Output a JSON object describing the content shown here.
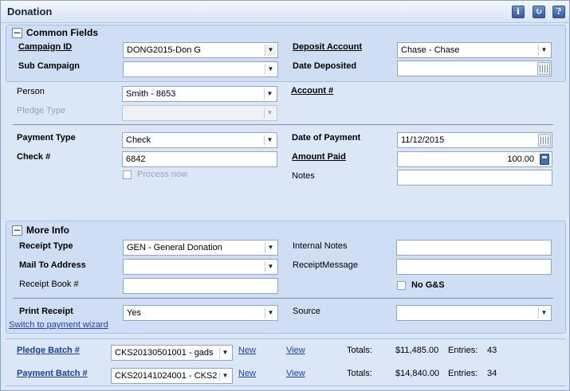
{
  "title": "Donation",
  "header_icons": [
    "info-icon",
    "refresh-icon",
    "help-icon"
  ],
  "common": {
    "section": "Common Fields",
    "campaign_id": {
      "label": "Campaign ID",
      "value": "DONG2015-Don G"
    },
    "sub_campaign": {
      "label": "Sub Campaign",
      "value": ""
    },
    "deposit_account": {
      "label": "Deposit Account",
      "value": "Chase - Chase"
    },
    "date_deposited": {
      "label": "Date Deposited",
      "value": ""
    }
  },
  "person": {
    "label": "Person",
    "value": "Smith - 8653"
  },
  "account_no": {
    "label": "Account #"
  },
  "pledge_type": {
    "label": "Pledge Type",
    "value": ""
  },
  "payment": {
    "type": {
      "label": "Payment Type",
      "value": "Check"
    },
    "check_no": {
      "label": "Check #",
      "value": "6842"
    },
    "process_now": {
      "label": "Process now",
      "checked": false
    },
    "date": {
      "label": "Date of Payment",
      "value": "11/12/2015"
    },
    "amount": {
      "label": "Amount Paid",
      "value": "100.00"
    },
    "notes": {
      "label": "Notes",
      "value": ""
    }
  },
  "more": {
    "section": "More Info",
    "receipt_type": {
      "label": "Receipt Type",
      "value": "GEN - General Donation"
    },
    "mail_to": {
      "label": "Mail To Address",
      "value": ""
    },
    "receipt_book": {
      "label": "Receipt Book #",
      "value": ""
    },
    "internal_notes": {
      "label": "Internal Notes",
      "value": ""
    },
    "receipt_message": {
      "label": "ReceiptMessage",
      "value": ""
    },
    "no_gs": {
      "label": "No G&S",
      "checked": false
    },
    "print_receipt": {
      "label": "Print Receipt",
      "value": "Yes"
    },
    "source": {
      "label": "Source",
      "value": ""
    }
  },
  "wizard_link": "Switch to payment wizard",
  "batches": [
    {
      "label": "Pledge Batch #",
      "value": "CKS20130501001 - gads",
      "new": "New",
      "view": "View",
      "totals_label": "Totals:",
      "totals": "$11,485.00",
      "entries_label": "Entries:",
      "entries": "43"
    },
    {
      "label": "Payment Batch #",
      "value": "CKS20141024001 - CKS2",
      "new": "New",
      "view": "View",
      "totals_label": "Totals:",
      "totals": "$14,840.00",
      "entries_label": "Entries:",
      "entries": "34"
    }
  ]
}
